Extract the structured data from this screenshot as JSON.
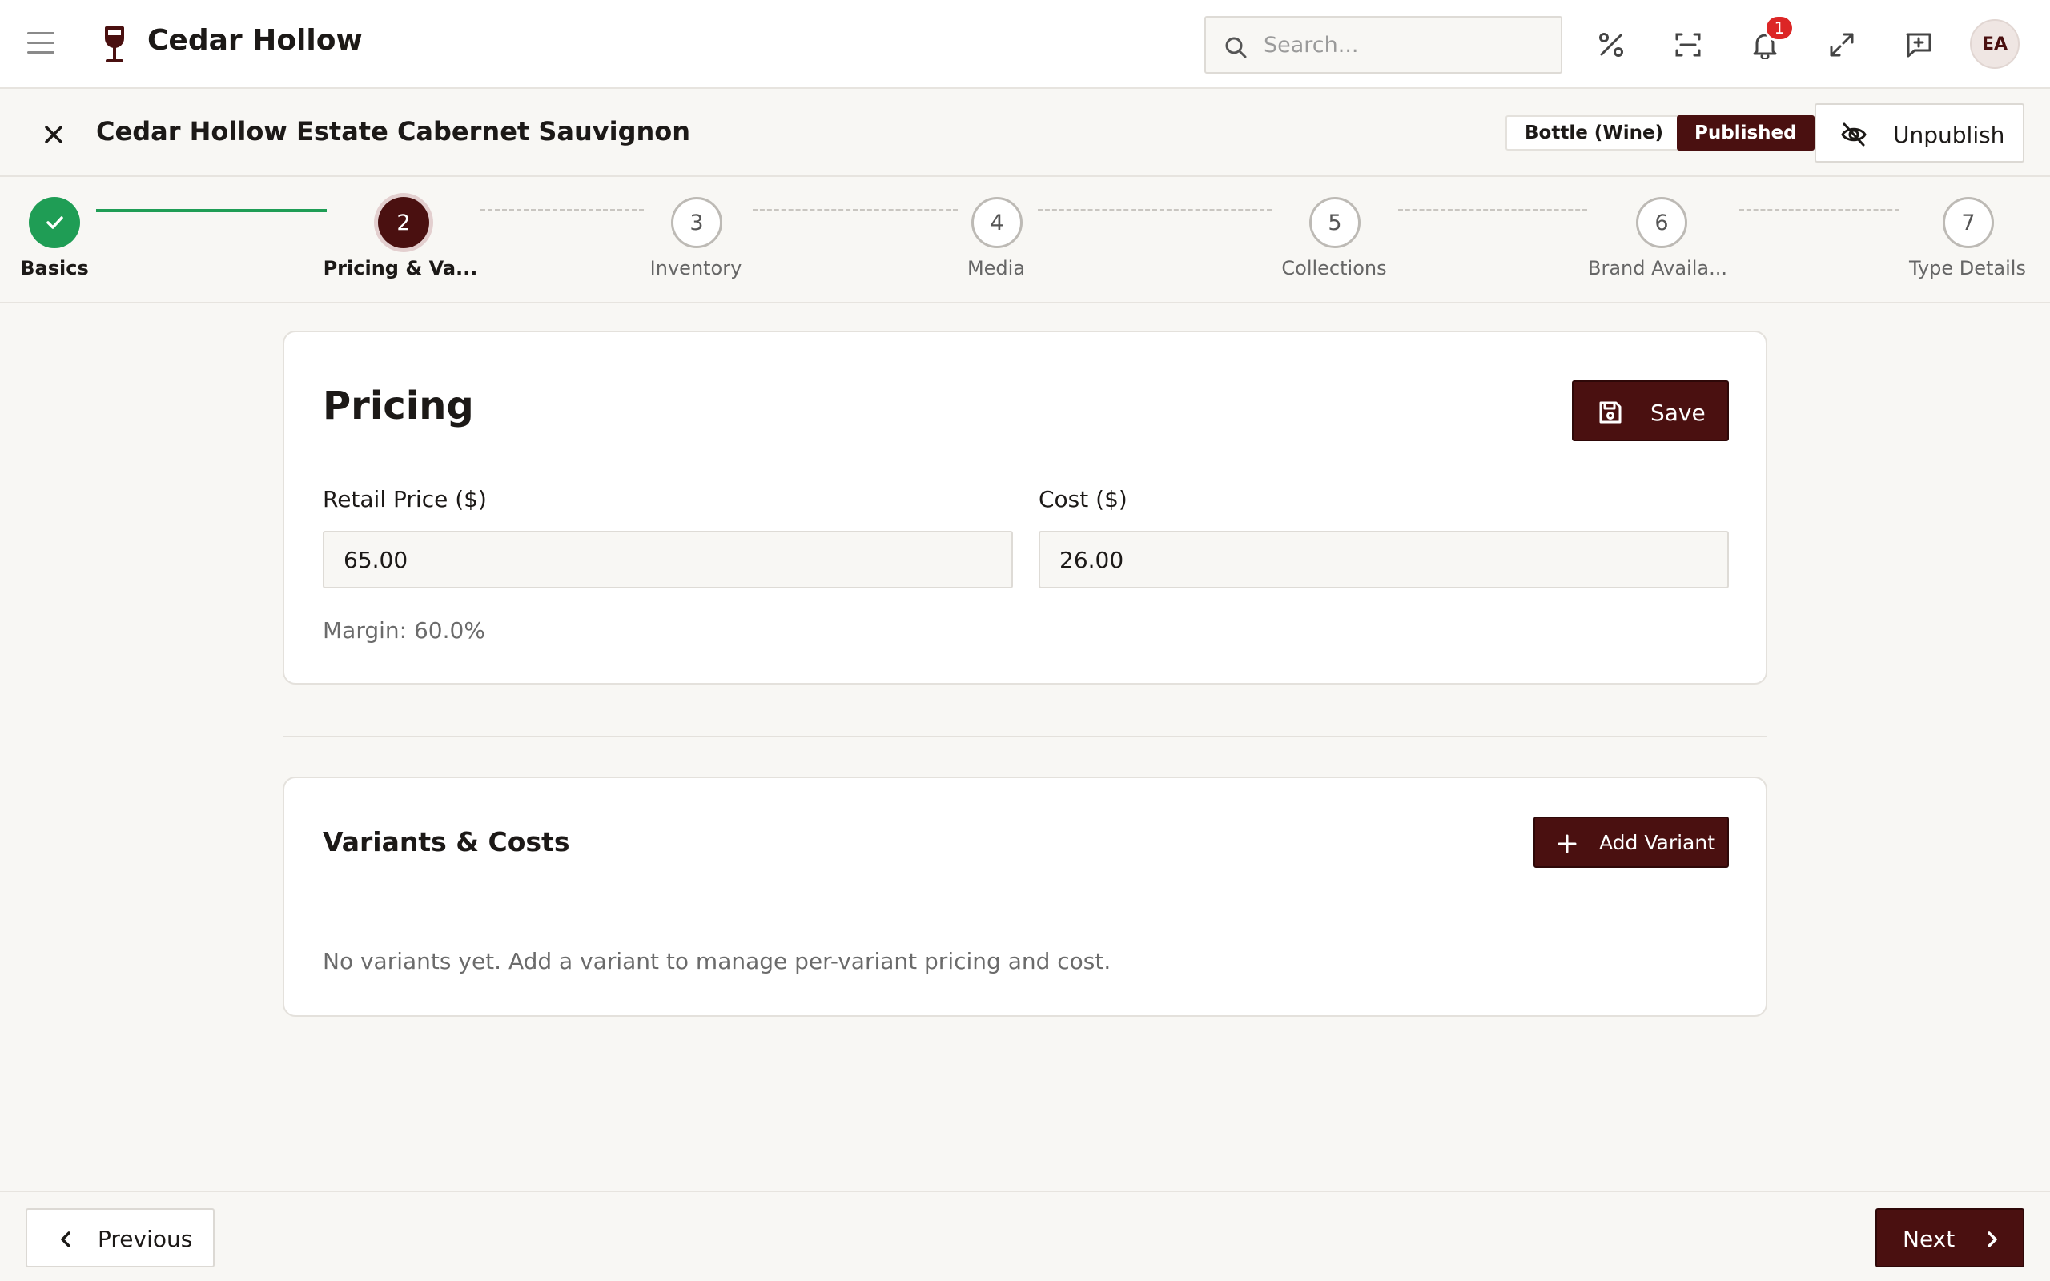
{
  "app": {
    "name": "Cedar Hollow",
    "brand_color": "#4a1010",
    "success_color": "#1f9d55"
  },
  "topbar": {
    "search_placeholder": "Search...",
    "notification_count": "1",
    "avatar_initials": "EA",
    "icons": [
      "menu-icon",
      "wine-glass-icon",
      "search-icon",
      "discount-icon",
      "scan-icon",
      "bell-icon",
      "expand-icon",
      "feedback-icon"
    ]
  },
  "product": {
    "title": "Cedar Hollow Estate Cabernet Sauvignon",
    "type_badge": "Bottle (Wine)",
    "status_badge": "Published",
    "unpublish_label": "Unpublish"
  },
  "stepper": {
    "steps": [
      {
        "number": "1",
        "label": "Basics",
        "state": "done"
      },
      {
        "number": "2",
        "label": "Pricing & Va...",
        "state": "current"
      },
      {
        "number": "3",
        "label": "Inventory",
        "state": "todo"
      },
      {
        "number": "4",
        "label": "Media",
        "state": "todo"
      },
      {
        "number": "5",
        "label": "Collections",
        "state": "todo"
      },
      {
        "number": "6",
        "label": "Brand Availa...",
        "state": "todo"
      },
      {
        "number": "7",
        "label": "Type Details",
        "state": "todo"
      }
    ]
  },
  "pricing": {
    "title": "Pricing",
    "save_label": "Save",
    "retail_label": "Retail Price ($)",
    "retail_value": "65.00",
    "cost_label": "Cost ($)",
    "cost_value": "26.00",
    "margin_text": "Margin: 60.0%"
  },
  "variants": {
    "title": "Variants & Costs",
    "add_label": "Add Variant",
    "empty_text": "No variants yet. Add a variant to manage per-variant pricing and cost."
  },
  "footer": {
    "previous_label": "Previous",
    "next_label": "Next"
  }
}
